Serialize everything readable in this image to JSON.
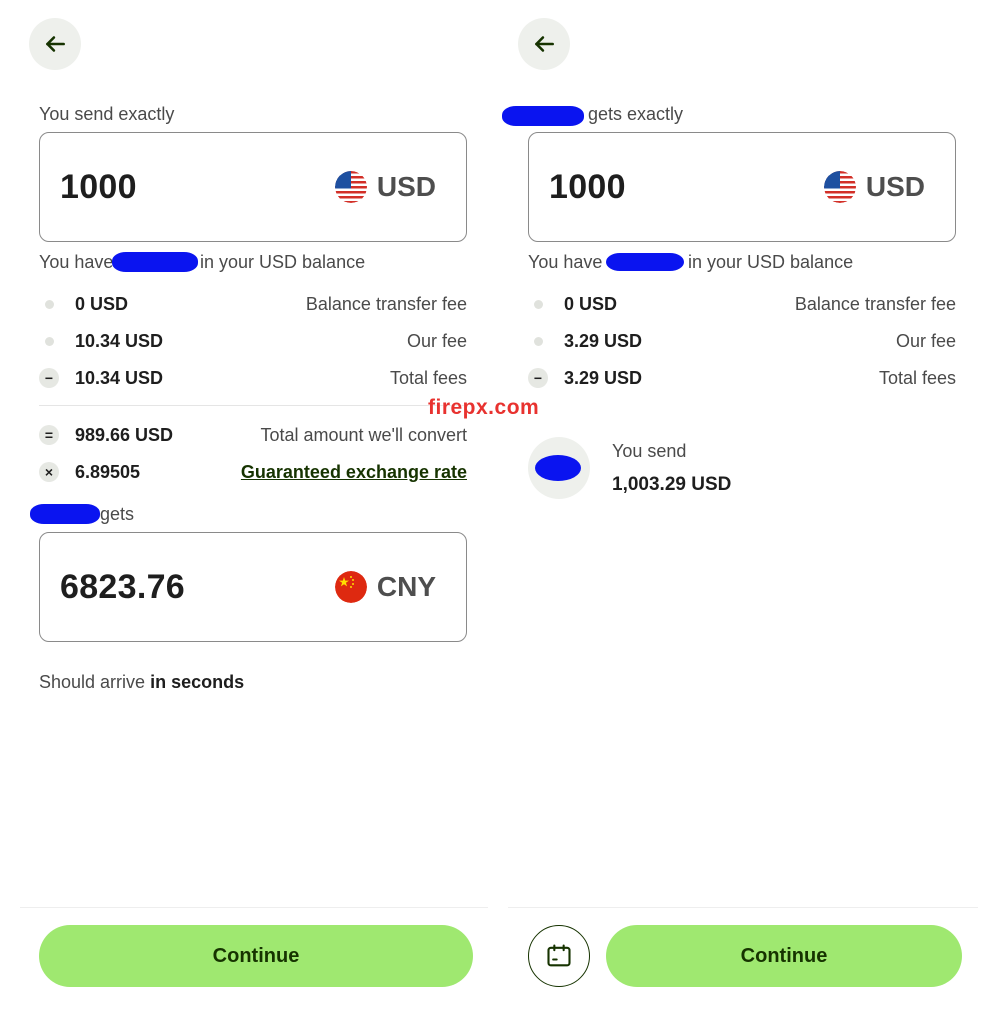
{
  "left": {
    "send_label": "You send exactly",
    "send_amount": "1000",
    "send_currency": "USD",
    "balance_prefix": "You have",
    "balance_suffix": "in your USD balance",
    "fees": [
      {
        "amount": "0 USD",
        "label": "Balance transfer fee",
        "bullet": "dot"
      },
      {
        "amount": "10.34 USD",
        "label": "Our fee",
        "bullet": "dot"
      },
      {
        "amount": "10.34 USD",
        "label": "Total fees",
        "bullet": "minus"
      }
    ],
    "convert": {
      "amount": "989.66 USD",
      "label": "Total amount we'll convert",
      "symbol": "="
    },
    "rate": {
      "amount": "6.89505",
      "label": "Guaranteed exchange rate",
      "symbol": "×"
    },
    "recipient_label": "gets",
    "receive_amount": "6823.76",
    "receive_currency": "CNY",
    "arrive_prefix": "Should arrive",
    "arrive_bold": "in seconds",
    "continue_label": "Continue"
  },
  "right": {
    "recipient_label": "gets exactly",
    "receive_amount": "1000",
    "receive_currency": "USD",
    "balance_prefix": "You have",
    "balance_suffix": "in your USD balance",
    "fees": [
      {
        "amount": "0 USD",
        "label": "Balance transfer fee",
        "bullet": "dot"
      },
      {
        "amount": "3.29 USD",
        "label": "Our fee",
        "bullet": "dot"
      },
      {
        "amount": "3.29 USD",
        "label": "Total fees",
        "bullet": "minus"
      }
    ],
    "you_send_label": "You send",
    "you_send_amount": "1,003.29 USD",
    "continue_label": "Continue"
  },
  "watermark": "firepx.com",
  "icons": {
    "back": "arrow-left-icon",
    "usd_flag": "us-flag-icon",
    "cny_flag": "china-flag-icon",
    "schedule": "calendar-icon"
  },
  "colors": {
    "accent": "#9fe870",
    "accent_text": "#163300",
    "redaction": "#0a14f0",
    "watermark": "#e8322f"
  }
}
